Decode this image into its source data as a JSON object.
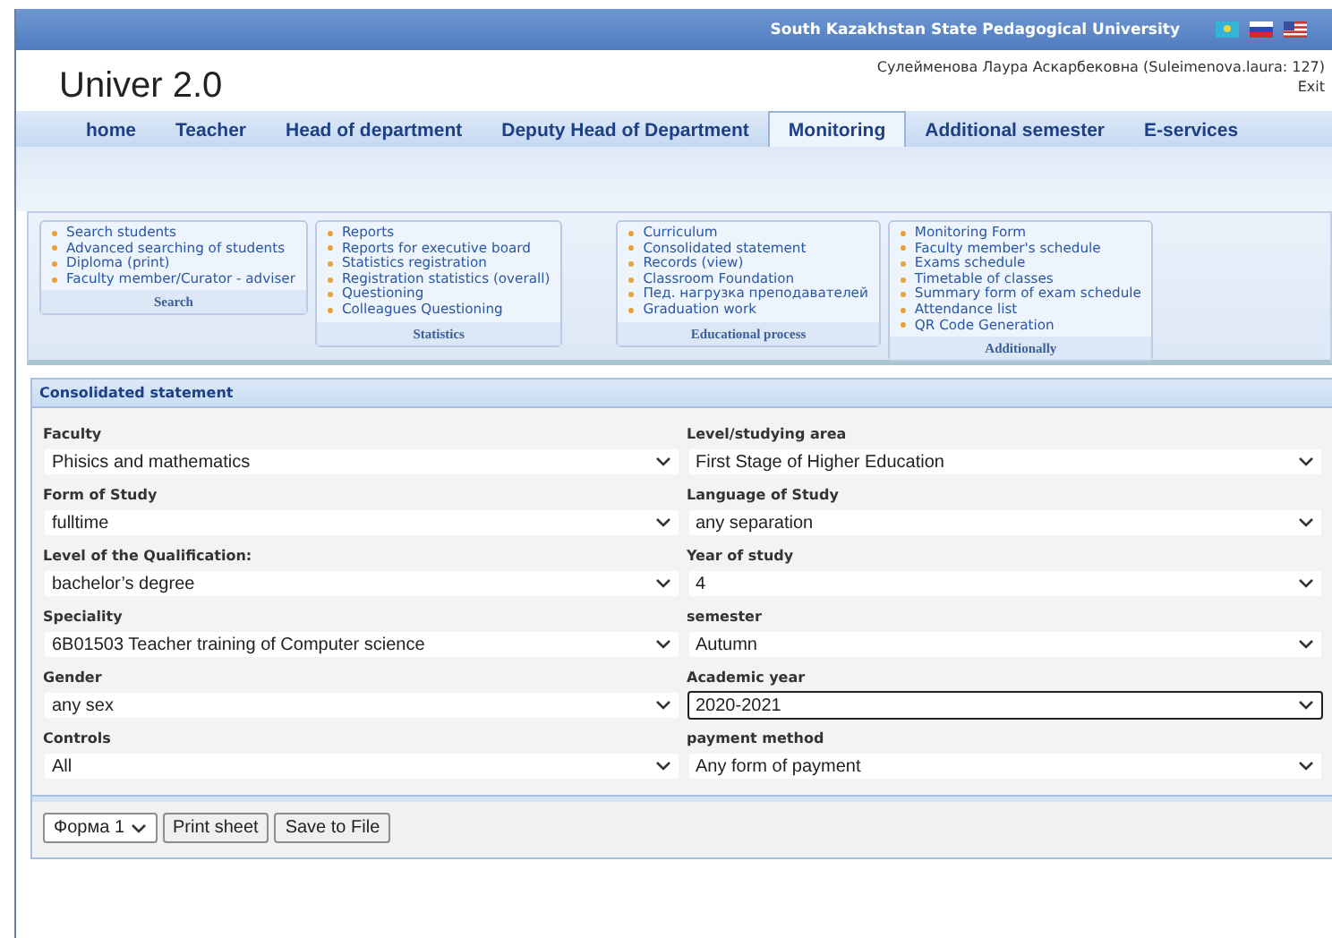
{
  "header": {
    "university": "South Kazakhstan State Pedagogical University",
    "logo": "Univer 2.0",
    "user": "Сулейменова Лаура Аскарбековна (Suleimenova.laura: 127)",
    "exit": "Exit"
  },
  "nav": [
    {
      "label": "home",
      "selected": false
    },
    {
      "label": "Teacher",
      "selected": false
    },
    {
      "label": "Head of department",
      "selected": false
    },
    {
      "label": "Deputy Head of Department",
      "selected": false
    },
    {
      "label": "Monitoring",
      "selected": true
    },
    {
      "label": "Additional semester",
      "selected": false
    },
    {
      "label": "E-services",
      "selected": false
    }
  ],
  "menu_groups": [
    {
      "title": "Search",
      "items": [
        "Search students",
        "Advanced searching of students",
        "Diploma (print)",
        "Faculty member/Curator - adviser"
      ]
    },
    {
      "title": "Statistics",
      "items": [
        "Reports",
        "Reports for executive board",
        "Statistics registration",
        "Registration statistics (overall)",
        "Questioning",
        "Colleagues Questioning"
      ]
    },
    {
      "title": "Educational process",
      "items": [
        "Curriculum",
        "Consolidated statement",
        "Records (view)",
        "Classroom Foundation",
        "Пед. нагрузка преподавателей",
        "Graduation work"
      ]
    },
    {
      "title": "Additionally",
      "items": [
        "Monitoring Form",
        "Faculty member's schedule",
        "Exams schedule",
        "Timetable of classes",
        "Summary form of exam schedule",
        "Attendance list",
        "QR Code Generation"
      ]
    }
  ],
  "form": {
    "title": "Consolidated statement",
    "fields": [
      {
        "label": "Faculty",
        "value": "Phisics and mathematics",
        "focused": false
      },
      {
        "label": "Level/studying area",
        "value": "First Stage of Higher Education",
        "focused": false
      },
      {
        "label": "Form of Study",
        "value": "fulltime",
        "focused": false
      },
      {
        "label": "Language of Study",
        "value": "any separation",
        "focused": false
      },
      {
        "label": "Level of the Qualification:",
        "value": "bachelor’s degree",
        "focused": false
      },
      {
        "label": "Year of study",
        "value": "4",
        "focused": false
      },
      {
        "label": "Speciality",
        "value": "6B01503 Teacher training of Computer science",
        "focused": false
      },
      {
        "label": "semester",
        "value": "Autumn",
        "focused": false
      },
      {
        "label": "Gender",
        "value": "any sex",
        "focused": false
      },
      {
        "label": "Academic year",
        "value": "2020-2021",
        "focused": true
      },
      {
        "label": "Controls",
        "value": "All",
        "focused": false
      },
      {
        "label": "payment method",
        "value": "Any form of payment",
        "focused": false
      }
    ],
    "form_select": "Форма 1",
    "buttons": [
      "Print sheet",
      "Save to File"
    ]
  }
}
